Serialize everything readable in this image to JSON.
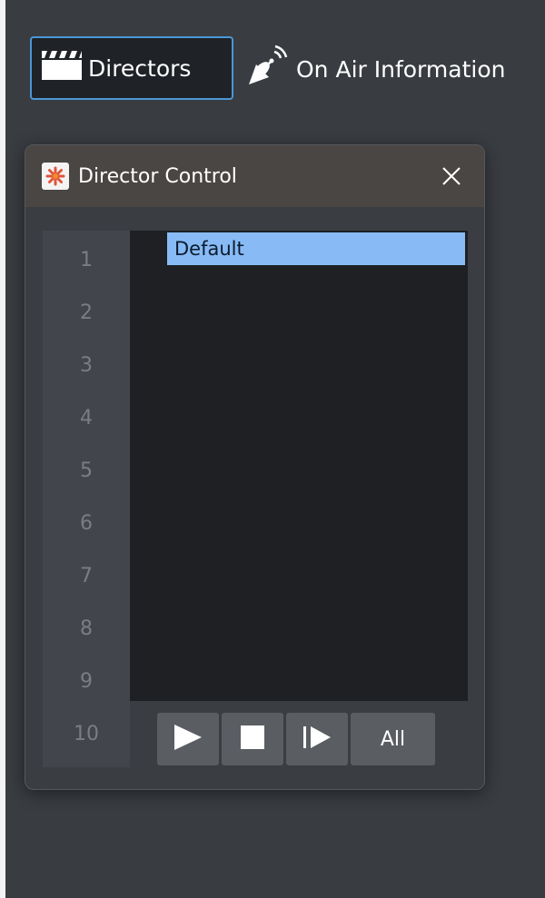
{
  "toolbar": {
    "directors": {
      "label": "Directors",
      "icon": "clapperboard-icon"
    },
    "on_air": {
      "label": "On Air Information",
      "icon": "satellite-dish-icon"
    }
  },
  "panel": {
    "title": "Director Control",
    "app_icon": "app-logo-icon",
    "close_icon": "close-icon",
    "line_numbers": [
      "1",
      "2",
      "3",
      "4",
      "5",
      "6",
      "7",
      "8",
      "9",
      "10"
    ],
    "items": [
      {
        "label": "Default",
        "selected": true
      }
    ],
    "controls": {
      "play_icon": "play-icon",
      "stop_icon": "stop-icon",
      "step_icon": "step-forward-icon",
      "all_label": "All"
    }
  },
  "colors": {
    "background": "#393c41",
    "selection": "#88bbf5",
    "active_border": "#4b97d6",
    "header": "#4a4644"
  }
}
